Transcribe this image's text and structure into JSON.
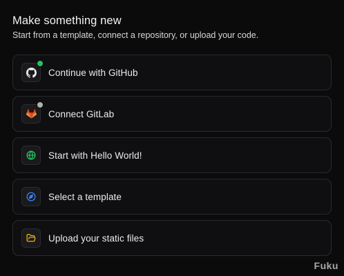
{
  "header": {
    "title": "Make something new",
    "subtitle": "Start from a template, connect a repository, or upload your code."
  },
  "options": [
    {
      "label": "Continue with GitHub",
      "icon": "github-icon",
      "status_color": "#22c55e"
    },
    {
      "label": "Connect GitLab",
      "icon": "gitlab-icon",
      "status_color": "#9ca3af"
    },
    {
      "label": "Start with Hello World!",
      "icon": "globe-icon",
      "icon_color": "#22c55e"
    },
    {
      "label": "Select a template",
      "icon": "compass-icon",
      "icon_color": "#3b82f6"
    },
    {
      "label": "Upload your static files",
      "icon": "folder-open-icon",
      "icon_color": "#eab308"
    }
  ],
  "watermark": {
    "text": "Fuku"
  }
}
